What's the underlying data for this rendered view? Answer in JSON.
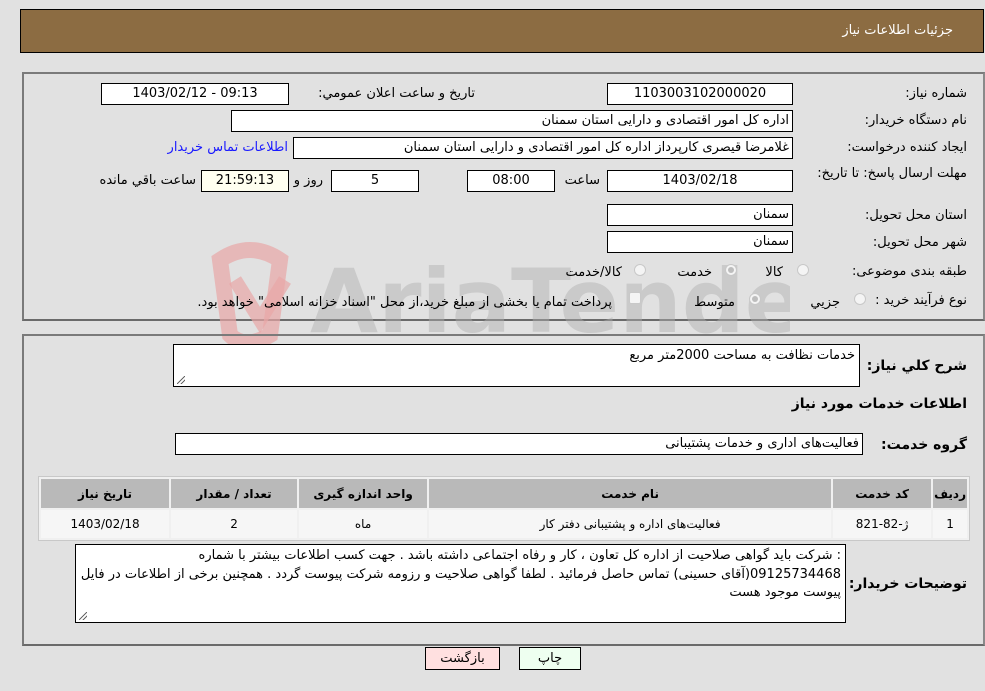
{
  "header": {
    "title": "جزئیات اطلاعات نیاز"
  },
  "details": {
    "need_number": {
      "label": "شماره نیاز:",
      "value": "1103003102000020"
    },
    "announce_datetime": {
      "label": "تاریخ و ساعت اعلان عمومي:",
      "value": "1403/02/12 - 09:13"
    },
    "buyer_org": {
      "label": "نام دستگاه خریدار:",
      "value": "اداره کل امور اقتصادی و دارایی استان سمنان"
    },
    "requester": {
      "label": "ایجاد کننده درخواست:",
      "value": "غلامرضا قیصری کارپرداز اداره کل امور اقتصادی و دارایی استان سمنان"
    },
    "buyer_contact_link": "اطلاعات تماس خریدار",
    "deadline": {
      "label": "مهلت ارسال پاسخ: تا تاریخ:",
      "date": "1403/02/18",
      "time_label": "ساعت",
      "time": "08:00",
      "days": "5",
      "days_label": "روز و",
      "remaining": "21:59:13",
      "remaining_label": "ساعت باقي مانده"
    },
    "delivery_province": {
      "label": "استان محل تحویل:",
      "value": "سمنان"
    },
    "delivery_city": {
      "label": "شهر محل تحویل:",
      "value": "سمنان"
    },
    "category": {
      "label": "طبقه بندی موضوعی:",
      "options": [
        {
          "label": "کالا",
          "checked": false
        },
        {
          "label": "خدمت",
          "checked": true
        },
        {
          "label": "کالا/خدمت",
          "checked": false
        }
      ]
    },
    "purchase_type": {
      "label": "نوع فرآیند خرید :",
      "options": [
        {
          "label": "جزيي",
          "checked": false
        },
        {
          "label": "متوسط",
          "checked": true
        }
      ],
      "treasury_note": "پرداخت تمام یا بخشی از مبلغ خرید،از محل \"اسناد خزانه اسلامی\" خواهد بود."
    }
  },
  "summary": {
    "label": "شرح کلي نياز:",
    "value": "خدمات نظافت به مساحت 2000متر مربع"
  },
  "services_section": {
    "title": "اطلاعات خدمات مورد نیاز",
    "group_label": "گروه خدمت:",
    "group_value": "فعالیت‌های اداری و خدمات پشتیبانی",
    "table": {
      "columns": [
        "ردیف",
        "کد خدمت",
        "نام خدمت",
        "واحد اندازه گیری",
        "تعداد / مقدار",
        "تاریخ نیاز"
      ],
      "rows": [
        [
          "1",
          "ژ-82-821",
          "فعالیت‌های اداره و پشتیبانی دفتر کار",
          "ماه",
          "2",
          "1403/02/18"
        ]
      ]
    }
  },
  "buyer_notes": {
    "label": "توضیحات خریدار:",
    "value": ": شرکت باید گواهی صلاحیت از اداره کل تعاون ، کار و رفاه اجتماعی داشته باشد . جهت کسب اطلاعات بیشتر با شماره 09125734468(آقای  حسینی) تماس حاصل فرمائید . لطفا گواهی صلاحیت و رزومه شرکت پیوست گردد . همچنین برخی از اطلاعات در فایل پیوست موجود هست"
  },
  "buttons": {
    "print": "چاپ",
    "back": "بازگشت"
  },
  "colors": {
    "header": "#8c6c42",
    "print_button": "#eefff0",
    "back_button": "#ffe0e0",
    "link": "#1a1aff"
  }
}
